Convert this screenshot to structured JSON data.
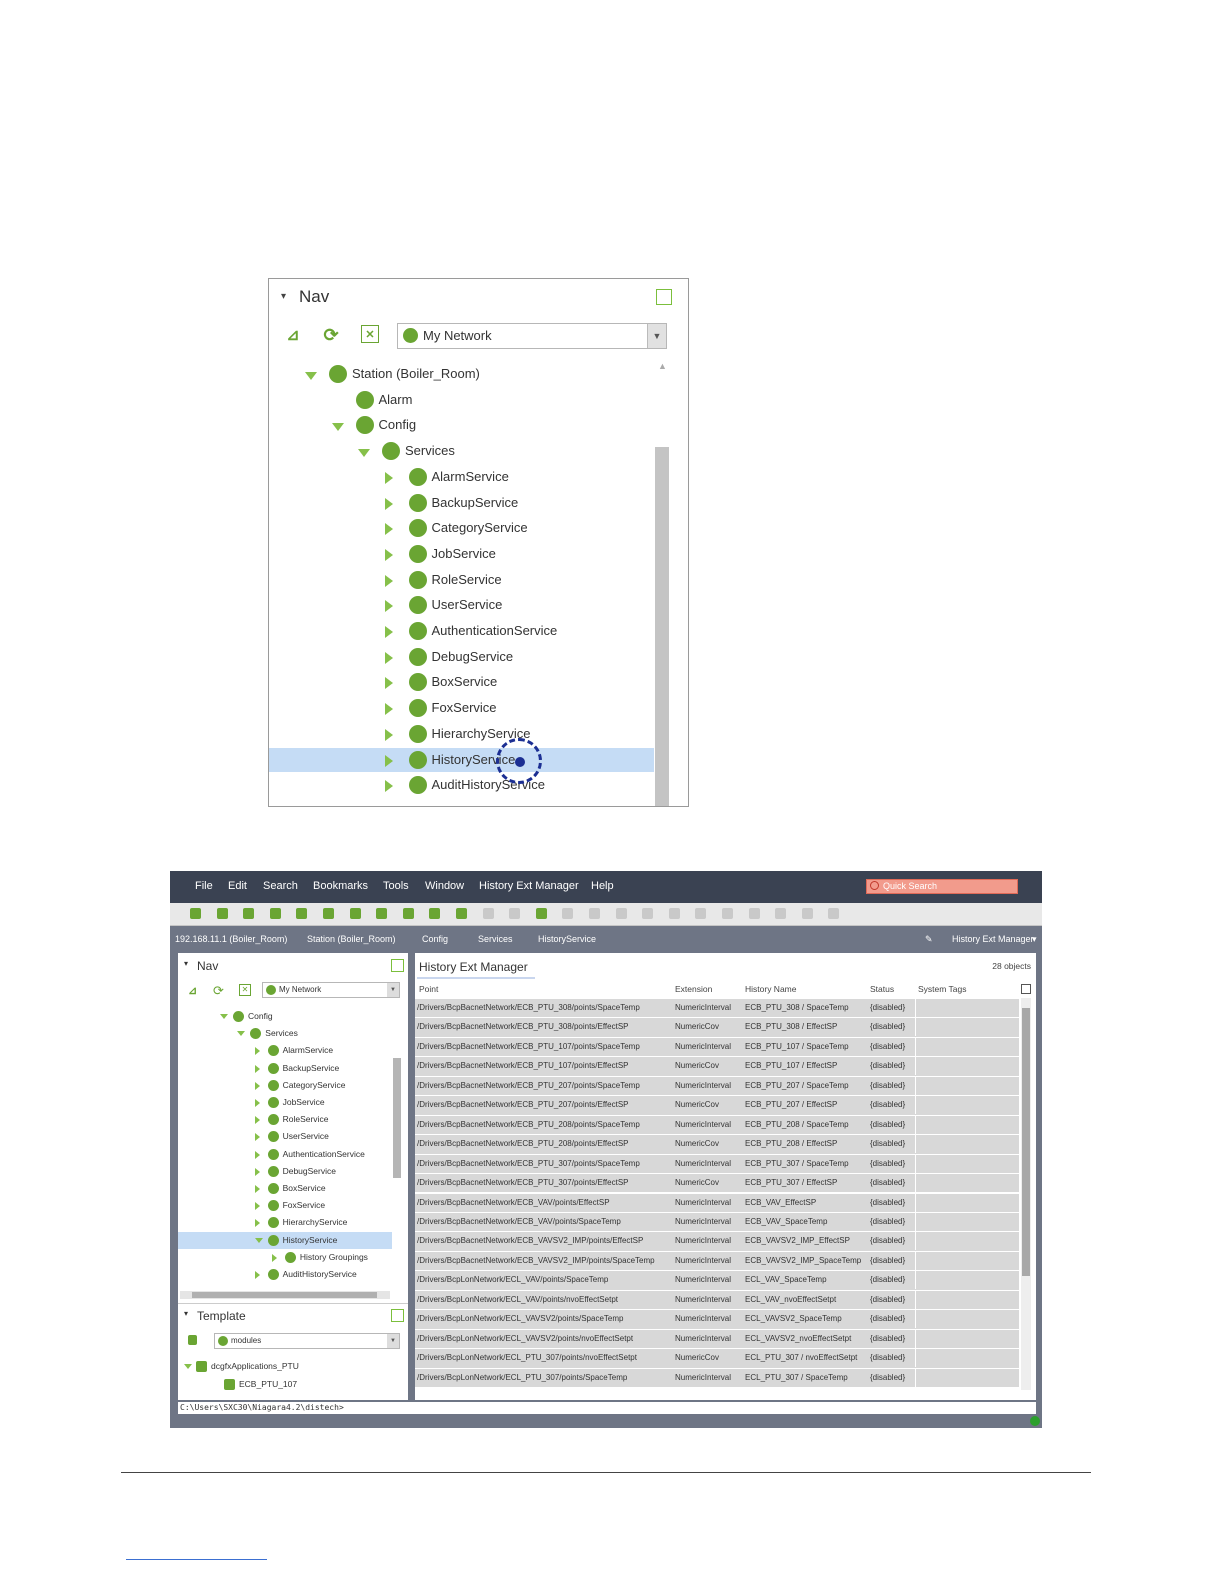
{
  "nav_zoom": {
    "title": "Nav",
    "network_combo": "My Network",
    "tree": [
      {
        "label": "Station (Boiler_Room)",
        "level": 0,
        "state": "expanded"
      },
      {
        "label": "Alarm",
        "level": 1,
        "state": "leaf"
      },
      {
        "label": "Config",
        "level": 1,
        "state": "expanded"
      },
      {
        "label": "Services",
        "level": 2,
        "state": "expanded"
      },
      {
        "label": "AlarmService",
        "level": 3,
        "state": "collapsed"
      },
      {
        "label": "BackupService",
        "level": 3,
        "state": "collapsed"
      },
      {
        "label": "CategoryService",
        "level": 3,
        "state": "collapsed"
      },
      {
        "label": "JobService",
        "level": 3,
        "state": "collapsed"
      },
      {
        "label": "RoleService",
        "level": 3,
        "state": "collapsed"
      },
      {
        "label": "UserService",
        "level": 3,
        "state": "collapsed"
      },
      {
        "label": "AuthenticationService",
        "level": 3,
        "state": "collapsed"
      },
      {
        "label": "DebugService",
        "level": 3,
        "state": "collapsed"
      },
      {
        "label": "BoxService",
        "level": 3,
        "state": "collapsed"
      },
      {
        "label": "FoxService",
        "level": 3,
        "state": "collapsed"
      },
      {
        "label": "HierarchyService",
        "level": 3,
        "state": "collapsed"
      },
      {
        "label": "HistoryService",
        "level": 3,
        "state": "collapsed",
        "selected": true
      },
      {
        "label": "AuditHistoryService",
        "level": 3,
        "state": "collapsed"
      }
    ]
  },
  "app": {
    "menu": [
      "File",
      "Edit",
      "Search",
      "Bookmarks",
      "Tools",
      "Window",
      "History Ext Manager",
      "Help"
    ],
    "quick_search_placeholder": "Quick Search",
    "breadcrumbs": [
      "192.168.11.1 (Boiler_Room)",
      "Station (Boiler_Room)",
      "Config",
      "Services",
      "HistoryService"
    ],
    "view_selector": "History Ext Manager",
    "nav": {
      "title": "Nav",
      "combo": "My Network",
      "tree": [
        {
          "label": "Config",
          "level": 0,
          "state": "expanded"
        },
        {
          "label": "Services",
          "level": 1,
          "state": "expanded"
        },
        {
          "label": "AlarmService",
          "level": 2,
          "state": "collapsed"
        },
        {
          "label": "BackupService",
          "level": 2,
          "state": "collapsed"
        },
        {
          "label": "CategoryService",
          "level": 2,
          "state": "collapsed"
        },
        {
          "label": "JobService",
          "level": 2,
          "state": "collapsed"
        },
        {
          "label": "RoleService",
          "level": 2,
          "state": "collapsed"
        },
        {
          "label": "UserService",
          "level": 2,
          "state": "collapsed"
        },
        {
          "label": "AuthenticationService",
          "level": 2,
          "state": "collapsed"
        },
        {
          "label": "DebugService",
          "level": 2,
          "state": "collapsed"
        },
        {
          "label": "BoxService",
          "level": 2,
          "state": "collapsed"
        },
        {
          "label": "FoxService",
          "level": 2,
          "state": "collapsed"
        },
        {
          "label": "HierarchyService",
          "level": 2,
          "state": "collapsed"
        },
        {
          "label": "HistoryService",
          "level": 2,
          "state": "expanded",
          "selected": true
        },
        {
          "label": "History Groupings",
          "level": 3,
          "state": "collapsed"
        },
        {
          "label": "AuditHistoryService",
          "level": 2,
          "state": "collapsed"
        }
      ]
    },
    "template": {
      "title": "Template",
      "combo": "modules",
      "tree": [
        {
          "label": "dcgfxApplications_PTU",
          "level": 0,
          "state": "expanded"
        },
        {
          "label": "ECB_PTU_107",
          "level": 1,
          "state": "leaf"
        }
      ]
    },
    "view_title": "History Ext Manager",
    "object_count": "28 objects",
    "columns": [
      "Point",
      "Extension",
      "History Name",
      "Status",
      "System Tags"
    ],
    "rows": [
      [
        "/Drivers/BcpBacnetNetwork/ECB_PTU_308/points/SpaceTemp",
        "NumericInterval",
        "ECB_PTU_308 / SpaceTemp",
        "{disabled}"
      ],
      [
        "/Drivers/BcpBacnetNetwork/ECB_PTU_308/points/EffectSP",
        "NumericCov",
        "ECB_PTU_308 / EffectSP",
        "{disabled}"
      ],
      [
        "/Drivers/BcpBacnetNetwork/ECB_PTU_107/points/SpaceTemp",
        "NumericInterval",
        "ECB_PTU_107 / SpaceTemp",
        "{disabled}"
      ],
      [
        "/Drivers/BcpBacnetNetwork/ECB_PTU_107/points/EffectSP",
        "NumericCov",
        "ECB_PTU_107 / EffectSP",
        "{disabled}"
      ],
      [
        "/Drivers/BcpBacnetNetwork/ECB_PTU_207/points/SpaceTemp",
        "NumericInterval",
        "ECB_PTU_207 / SpaceTemp",
        "{disabled}"
      ],
      [
        "/Drivers/BcpBacnetNetwork/ECB_PTU_207/points/EffectSP",
        "NumericCov",
        "ECB_PTU_207 / EffectSP",
        "{disabled}"
      ],
      [
        "/Drivers/BcpBacnetNetwork/ECB_PTU_208/points/SpaceTemp",
        "NumericInterval",
        "ECB_PTU_208 / SpaceTemp",
        "{disabled}"
      ],
      [
        "/Drivers/BcpBacnetNetwork/ECB_PTU_208/points/EffectSP",
        "NumericCov",
        "ECB_PTU_208 / EffectSP",
        "{disabled}"
      ],
      [
        "/Drivers/BcpBacnetNetwork/ECB_PTU_307/points/SpaceTemp",
        "NumericInterval",
        "ECB_PTU_307 / SpaceTemp",
        "{disabled}"
      ],
      [
        "/Drivers/BcpBacnetNetwork/ECB_PTU_307/points/EffectSP",
        "NumericCov",
        "ECB_PTU_307 / EffectSP",
        "{disabled}"
      ],
      [
        "/Drivers/BcpBacnetNetwork/ECB_VAV/points/EffectSP",
        "NumericInterval",
        "ECB_VAV_EffectSP",
        "{disabled}"
      ],
      [
        "/Drivers/BcpBacnetNetwork/ECB_VAV/points/SpaceTemp",
        "NumericInterval",
        "ECB_VAV_SpaceTemp",
        "{disabled}"
      ],
      [
        "/Drivers/BcpBacnetNetwork/ECB_VAVSV2_IMP/points/EffectSP",
        "NumericInterval",
        "ECB_VAVSV2_IMP_EffectSP",
        "{disabled}"
      ],
      [
        "/Drivers/BcpBacnetNetwork/ECB_VAVSV2_IMP/points/SpaceTemp",
        "NumericInterval",
        "ECB_VAVSV2_IMP_SpaceTemp",
        "{disabled}"
      ],
      [
        "/Drivers/BcpLonNetwork/ECL_VAV/points/SpaceTemp",
        "NumericInterval",
        "ECL_VAV_SpaceTemp",
        "{disabled}"
      ],
      [
        "/Drivers/BcpLonNetwork/ECL_VAV/points/nvoEffectSetpt",
        "NumericInterval",
        "ECL_VAV_nvoEffectSetpt",
        "{disabled}"
      ],
      [
        "/Drivers/BcpLonNetwork/ECL_VAVSV2/points/SpaceTemp",
        "NumericInterval",
        "ECL_VAVSV2_SpaceTemp",
        "{disabled}"
      ],
      [
        "/Drivers/BcpLonNetwork/ECL_VAVSV2/points/nvoEffectSetpt",
        "NumericInterval",
        "ECL_VAVSV2_nvoEffectSetpt",
        "{disabled}"
      ],
      [
        "/Drivers/BcpLonNetwork/ECL_PTU_307/points/nvoEffectSetpt",
        "NumericCov",
        "ECL_PTU_307 / nvoEffectSetpt",
        "{disabled}"
      ],
      [
        "/Drivers/BcpLonNetwork/ECL_PTU_307/points/SpaceTemp",
        "NumericInterval",
        "ECL_PTU_307 / SpaceTemp",
        "{disabled}"
      ]
    ],
    "console": "C:\\Users\\SXC30\\Niagara4.2\\distech>"
  },
  "colors": {
    "accent_green": "#6aa533",
    "menubar": "#3a4252",
    "selection": "#c5dcf5",
    "cursor": "#1c2f93"
  }
}
